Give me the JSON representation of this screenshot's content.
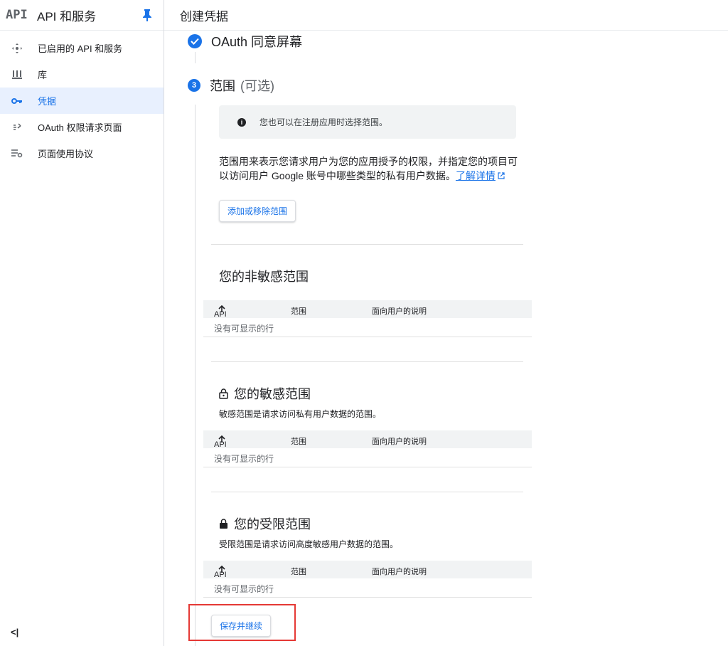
{
  "sidebar": {
    "logo": "API",
    "title": "API 和服务",
    "items": [
      {
        "label": "已启用的 API 和服务",
        "icon": "api-hub-icon"
      },
      {
        "label": "库",
        "icon": "library-icon"
      },
      {
        "label": "凭据",
        "icon": "key-icon",
        "active": true
      },
      {
        "label": "OAuth 权限请求页面",
        "icon": "oauth-consent-icon"
      },
      {
        "label": "页面使用协议",
        "icon": "settings-list-icon"
      }
    ],
    "collapse_label": "<|"
  },
  "topbar": {
    "title": "创建凭据"
  },
  "steps": {
    "step1_label": "OAuth 同意屏幕",
    "step3_number": "3",
    "step3_label": "范围",
    "step3_optional": "(可选)"
  },
  "info": {
    "text": "您也可以在注册应用时选择范围。"
  },
  "description": {
    "text": "范围用来表示您请求用户为您的应用授予的权限，并指定您的项目可以访问用户 Google 账号中哪些类型的私有用户数据。",
    "link": "了解详情"
  },
  "add_button": "添加或移除范围",
  "sections": [
    {
      "title": "您的非敏感范围",
      "desc": "",
      "icon": ""
    },
    {
      "title": "您的敏感范围",
      "desc": "敏感范围是请求访问私有用户数据的范围。",
      "icon": "lock-open-icon"
    },
    {
      "title": "您的受限范围",
      "desc": "受限范围是请求访问高度敏感用户数据的范围。",
      "icon": "lock-icon"
    }
  ],
  "table": {
    "col_api": "API",
    "col_scope": "范围",
    "col_desc": "面向用户的说明",
    "empty": "没有可显示的行"
  },
  "save_button": "保存并继续",
  "colors": {
    "accent": "#1a73e8",
    "highlight": "#e53935"
  }
}
